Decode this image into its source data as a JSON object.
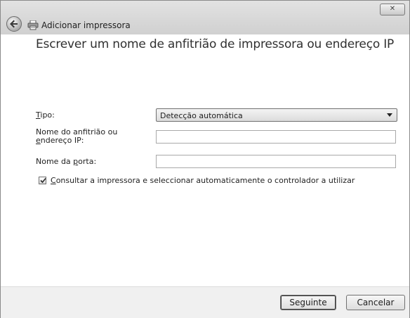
{
  "window": {
    "title": "Adicionar impressora",
    "close_label": "✕"
  },
  "page": {
    "heading": "Escrever um nome de anfitrião de impressora ou endereço IP"
  },
  "form": {
    "type_label_first": "T",
    "type_label_rest": "ipo:",
    "type_value": "Detecção automática",
    "host_label_line1": "Nome do anfitrião ou",
    "host_label_line2_first": "e",
    "host_label_line2_rest": "ndereço IP:",
    "host_value": "",
    "port_label_pre": "Nome da ",
    "port_label_key": "p",
    "port_label_rest": "orta:",
    "port_value": "",
    "query_checkbox_key": "C",
    "query_checkbox_rest": "onsultar a impressora e seleccionar automaticamente o controlador a utilizar",
    "query_checked": true
  },
  "footer": {
    "next_label": "Seguinte",
    "cancel_label": "Cancelar"
  }
}
